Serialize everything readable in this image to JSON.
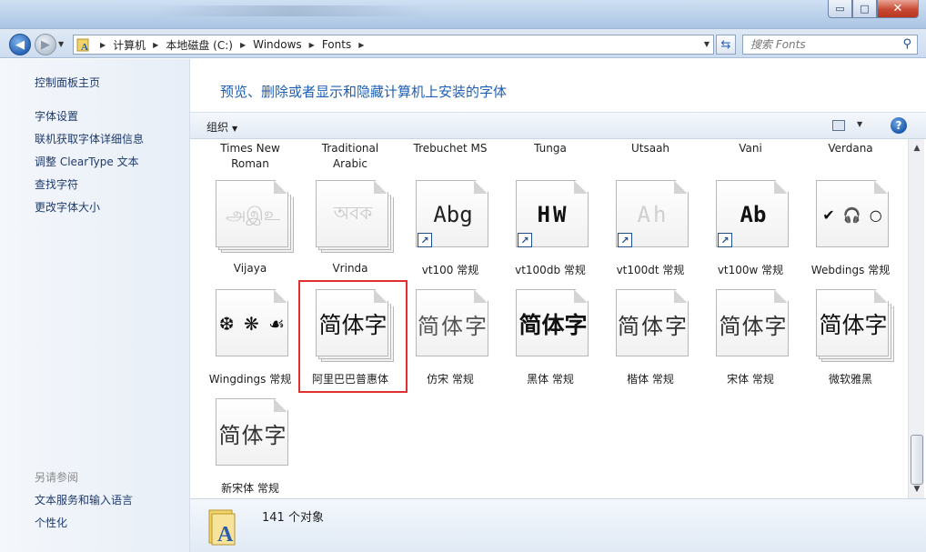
{
  "window": {
    "controls": {
      "minimize": "▭",
      "maximize": "□",
      "close": "✕"
    }
  },
  "nav": {
    "breadcrumbs": [
      "计算机",
      "本地磁盘 (C:)",
      "Windows",
      "Fonts"
    ],
    "search_placeholder": "搜索 Fonts",
    "icons": {
      "back": "arrow-left-icon",
      "forward": "arrow-right-icon",
      "refresh": "refresh-icon",
      "search": "search-icon"
    }
  },
  "sidebar": {
    "home": "控制面板主页",
    "items": [
      "字体设置",
      "联机获取字体详细信息",
      "调整 ClearType 文本",
      "查找字符",
      "更改字体大小"
    ],
    "see_also_heading": "另请参阅",
    "see_also": [
      "文本服务和输入语言",
      "个性化"
    ]
  },
  "content": {
    "title": "预览、删除或者显示和隐藏计算机上安装的字体",
    "organize": "组织",
    "help": "?"
  },
  "partial_row": [
    "Times New Roman",
    "Traditional Arabic",
    "Trebuchet MS",
    "Tunga",
    "Utsaah",
    "Vani",
    "Verdana"
  ],
  "fonts": [
    {
      "label": "Vijaya",
      "sample": "அஇஉ",
      "stacked": true,
      "shortcut": false,
      "faded": true
    },
    {
      "label": "Vrinda",
      "sample": "অবক",
      "stacked": true,
      "shortcut": false,
      "faded": true
    },
    {
      "label": "vt100 常规",
      "sample": "Abg",
      "stacked": false,
      "shortcut": true,
      "faded": false
    },
    {
      "label": "vt100db 常规",
      "sample": "HW",
      "stacked": false,
      "shortcut": true,
      "faded": false
    },
    {
      "label": "vt100dt 常规",
      "sample": "Ah",
      "stacked": false,
      "shortcut": true,
      "faded": true
    },
    {
      "label": "vt100w 常规",
      "sample": "Ab",
      "stacked": false,
      "shortcut": true,
      "faded": false
    },
    {
      "label": "Webdings 常规",
      "sample": "✔ 🎧 ○",
      "stacked": false,
      "shortcut": false,
      "faded": false
    },
    {
      "label": "Wingdings 常规",
      "sample": "❆ ❋ ☙",
      "stacked": false,
      "shortcut": false,
      "faded": false
    },
    {
      "label": "阿里巴巴普惠体",
      "sample": "简体字",
      "stacked": true,
      "shortcut": false,
      "faded": false,
      "selected": true
    },
    {
      "label": "仿宋 常规",
      "sample": "简体字",
      "stacked": false,
      "shortcut": false,
      "faded": false
    },
    {
      "label": "黑体 常规",
      "sample": "简体字",
      "stacked": false,
      "shortcut": false,
      "faded": false
    },
    {
      "label": "楷体 常规",
      "sample": "简体字",
      "stacked": false,
      "shortcut": false,
      "faded": false
    },
    {
      "label": "宋体 常规",
      "sample": "简体字",
      "stacked": false,
      "shortcut": false,
      "faded": false
    },
    {
      "label": "微软雅黑",
      "sample": "简体字",
      "stacked": true,
      "shortcut": false,
      "faded": false
    },
    {
      "label": "新宋体 常规",
      "sample": "简体字",
      "stacked": false,
      "shortcut": false,
      "faded": false
    }
  ],
  "details": {
    "count": "141 个对象"
  }
}
